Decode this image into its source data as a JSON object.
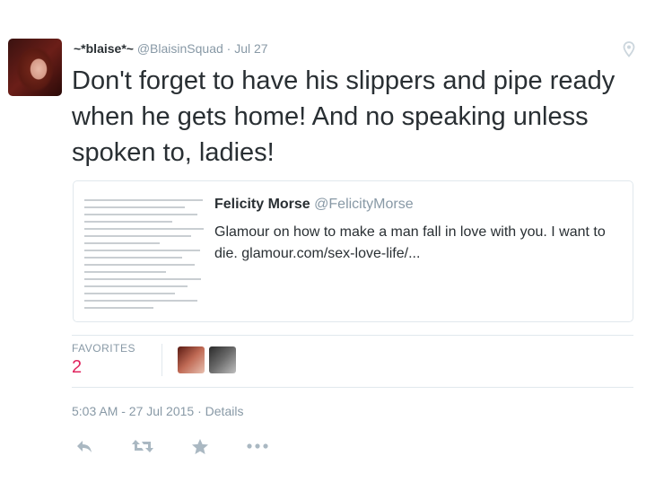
{
  "tweet": {
    "author_name": "~*blaise*~",
    "author_handle": "@BlaisinSquad",
    "separator": "·",
    "date": "Jul 27",
    "text": "Don't forget to have his slippers and pipe ready when he gets home! And no speaking unless spoken to, ladies!"
  },
  "quote": {
    "author_name": "Felicity Morse",
    "author_handle": "@FelicityMorse",
    "text": "Glamour on how to make a man fall in love with you. I want to die. glamour.com/sex-love-life/..."
  },
  "stats": {
    "favorites_label": "FAVORITES",
    "favorites_count": "2"
  },
  "meta": {
    "timestamp": "5:03 AM - 27 Jul 2015",
    "separator": "·",
    "details_label": "Details"
  },
  "icons": {
    "geo": "map-pin-icon",
    "reply": "reply-icon",
    "retweet": "retweet-icon",
    "favorite": "star-icon",
    "more": "more-icon"
  },
  "colors": {
    "text": "#292f33",
    "secondary": "#8899a6",
    "favorite_count": "#e0245e",
    "action_icon": "#aab8c2",
    "border": "#e1e8ed"
  }
}
